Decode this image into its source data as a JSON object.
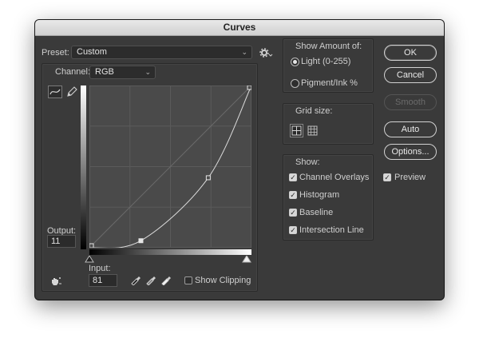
{
  "window": {
    "title": "Curves"
  },
  "preset": {
    "label": "Preset:",
    "value": "Custom"
  },
  "channel": {
    "label": "Channel:",
    "value": "RGB"
  },
  "output": {
    "label": "Output:",
    "value": "11"
  },
  "input": {
    "label": "Input:",
    "value": "81"
  },
  "show_clipping": {
    "label": "Show Clipping",
    "checked": false
  },
  "show_amount": {
    "title": "Show Amount of:",
    "light_label": "Light",
    "light_range": "(0-255)",
    "pigment_label": "Pigment/Ink %",
    "selected": "light"
  },
  "grid_size": {
    "title": "Grid size:",
    "selected": "4x4"
  },
  "show": {
    "title": "Show:",
    "items": [
      {
        "label": "Channel Overlays",
        "checked": true
      },
      {
        "label": "Histogram",
        "checked": true
      },
      {
        "label": "Baseline",
        "checked": true
      },
      {
        "label": "Intersection Line",
        "checked": true
      }
    ]
  },
  "buttons": {
    "ok": "OK",
    "cancel": "Cancel",
    "smooth": "Smooth",
    "auto": "Auto",
    "options": "Options..."
  },
  "preview": {
    "label": "Preview",
    "checked": true
  },
  "curve": {
    "input_range": [
      0,
      255
    ],
    "output_range": [
      0,
      255
    ],
    "points": [
      [
        0,
        0
      ],
      [
        81,
        11
      ],
      [
        187,
        110
      ],
      [
        255,
        255
      ]
    ],
    "selected_point_index": 1
  },
  "colors": {
    "dialog_bg": "#3a3a3a",
    "graph_bg": "#4a4a4a",
    "curve_line": "#dcdcdc",
    "grid_line": "#5a5a5a"
  }
}
